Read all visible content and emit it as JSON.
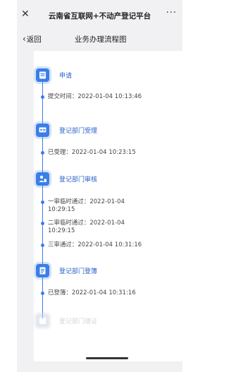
{
  "window": {
    "title": "云南省互联网+不动产登记平台",
    "close_icon": "close-icon",
    "more_icon": "more-icon"
  },
  "nav": {
    "back_label": "返回",
    "page_title": "业务办理流程图"
  },
  "steps": [
    {
      "label": "申请",
      "icon": "form-icon",
      "status": "done"
    },
    {
      "label": "登记部门受理",
      "icon": "id-card-icon",
      "status": "done"
    },
    {
      "label": "登记部门审核",
      "icon": "review-user-icon",
      "status": "done"
    },
    {
      "label": "登记部门登簿",
      "icon": "register-book-icon",
      "status": "done"
    },
    {
      "label": "登记部门缮证",
      "icon": "certificate-icon",
      "status": "pending"
    }
  ],
  "entries": {
    "apply": "提交时间：2022-01-04 10:13:46",
    "accept": "已受理：2022-01-04 10:23:15",
    "review1_line1": "一审临时通过：2022-01-04",
    "review1_line2": "10:29:15",
    "review2_line1": "二审临时通过：2022-01-04",
    "review2_line2": "10:29:15",
    "review3": "三审通过：2022-01-04 10:31:16",
    "register": "已登簿：2022-01-04 10:31:16"
  },
  "colors": {
    "accent": "#3a7ee8",
    "label": "#2a62c8",
    "pending": "#d3d6db"
  }
}
